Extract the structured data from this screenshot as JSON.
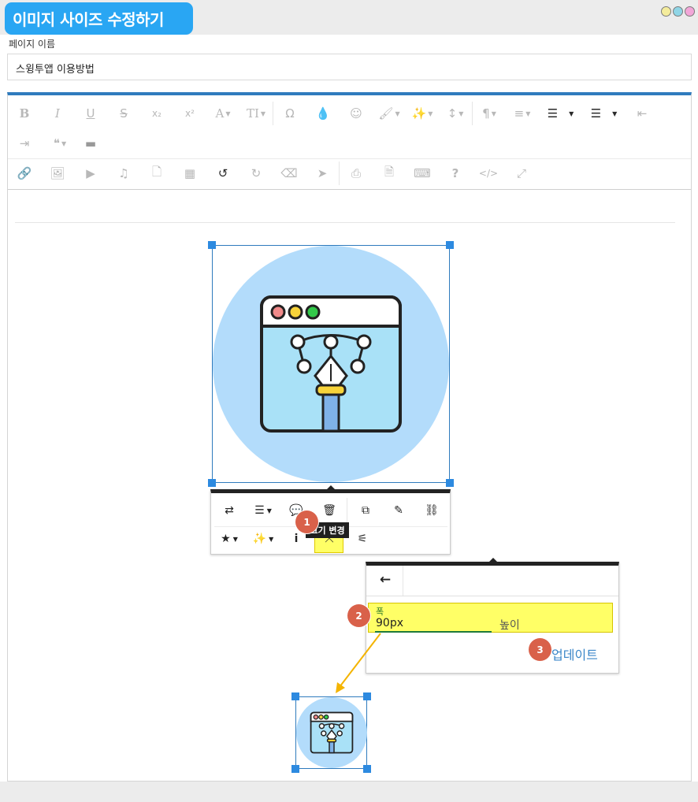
{
  "title": "이미지 사이즈 수정하기",
  "window_dots": [
    "#f4ec9c",
    "#8fd5e6",
    "#f2a6d8"
  ],
  "page_name_label": "페이지 이름",
  "page_name_value": "스윙투앱 이용방법",
  "toolbar_row1": [
    "bold-icon",
    "italic-icon",
    "underline-icon",
    "strikethrough-icon",
    "subscript-icon",
    "superscript-icon",
    "font-color-icon",
    "font-size-icon",
    "omega-icon",
    "ink-drop-icon",
    "smiley-icon",
    "brush-icon",
    "magic-wand-icon",
    "line-height-icon",
    "paragraph-icon",
    "align-icon",
    "ordered-list-icon",
    "unordered-list-icon",
    "outdent-icon"
  ],
  "toolbar_row2": [
    "indent-icon",
    "quote-icon",
    "horizontal-rule-icon"
  ],
  "toolbar_row3": [
    "link-icon",
    "image-icon",
    "video-icon",
    "music-icon",
    "file-icon",
    "table-icon",
    "undo-icon",
    "redo-icon",
    "eraser-icon",
    "pointer-icon",
    "print-icon",
    "pdf-icon",
    "keyboard-icon",
    "help-icon",
    "code-view-icon",
    "fullscreen-icon"
  ],
  "image_popover": {
    "row1": [
      "replace-icon",
      "align-icon",
      "caption-icon",
      "delete-icon",
      "open-link-icon",
      "edit-link-icon",
      "unlink-icon"
    ],
    "row2": [
      "style-icon",
      "effects-icon",
      "info-icon",
      "resize-icon",
      "advanced-icon"
    ]
  },
  "tooltip": "크기 변경",
  "badges": [
    "1",
    "2",
    "3"
  ],
  "resize_popover": {
    "back_icon": "arrow-left-icon",
    "width_label": "폭",
    "width_value": "90px",
    "height_label": "높이",
    "update_label": "업데이트"
  },
  "colors": {
    "accent": "#29a6f3",
    "selection": "#2d8ae0",
    "highlight": "#ffff66",
    "badge": "#d9614a",
    "arrow": "#f4b400",
    "image_circle": "#b3dcfb"
  }
}
